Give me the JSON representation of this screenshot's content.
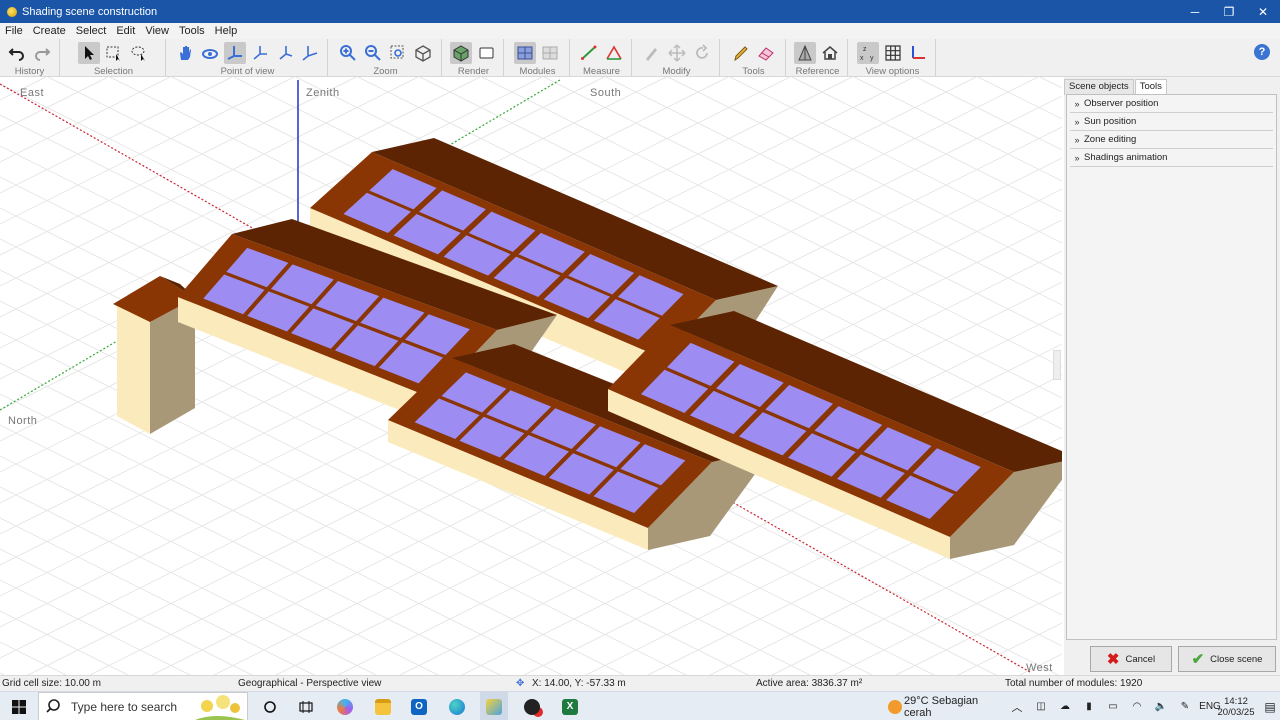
{
  "window": {
    "title": "Shading scene construction",
    "minimize": "─",
    "maximize": "❐",
    "close": "✕"
  },
  "menu": [
    "File",
    "Create",
    "Select",
    "Edit",
    "View",
    "Tools",
    "Help"
  ],
  "toolbar_groups": {
    "history": "History",
    "selection": "Selection",
    "point_of_view": "Point of view",
    "zoom": "Zoom",
    "render": "Render",
    "modules": "Modules",
    "measure": "Measure",
    "modify": "Modify",
    "tools": "Tools",
    "reference": "Reference",
    "view_options": "View options"
  },
  "help_label": "?",
  "viewport": {
    "labels": {
      "east": "East",
      "zenith": "Zenith",
      "south": "South",
      "north": "North",
      "west": "West"
    },
    "colors": {
      "roof": "#8a3504",
      "ridge": "#5c2402",
      "panel": "#9d8cf2",
      "wall_light": "#fbeabb",
      "wall_dark": "#a89878",
      "grid": "#e6e6e6"
    }
  },
  "right_panel": {
    "tabs": [
      "Scene objects",
      "Tools"
    ],
    "active_tab": "Tools",
    "sections": [
      "Observer position",
      "Sun position",
      "Zone editing",
      "Shadings animation"
    ],
    "cancel_label": "Cancel",
    "close_label": "Close scene"
  },
  "status": {
    "grid": "Grid cell size: 10.00 m",
    "view": "Geographical - Perspective view",
    "coords": "X: 14.00, Y: -57.33 m",
    "area": "Active area: 3836.37 m²",
    "modules": "Total number of modules: 1920"
  },
  "taskbar": {
    "search_placeholder": "Type here to search",
    "weather": "29°C  Sebagian cerah",
    "lang": "ENG",
    "time": "14:12",
    "date": "20/03/25"
  }
}
